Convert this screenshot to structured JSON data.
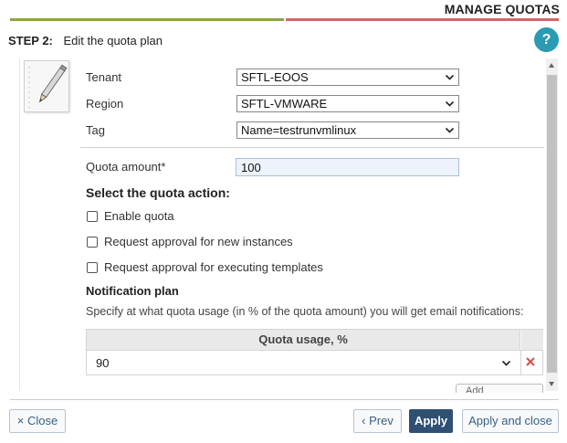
{
  "window": {
    "title": "MANAGE QUOTAS"
  },
  "step": {
    "number": "STEP 2:",
    "title": "Edit the quota plan"
  },
  "help": {
    "label": "?"
  },
  "fields": {
    "tenant": {
      "label": "Tenant",
      "value": "SFTL-EOOS"
    },
    "region": {
      "label": "Region",
      "value": "SFTL-VMWARE"
    },
    "tag": {
      "label": "Tag",
      "value": "Name=testrunvmlinux"
    },
    "quota_amount": {
      "label": "Quota amount*",
      "value": "100"
    }
  },
  "action_section": {
    "title": "Select the quota action:",
    "options": [
      {
        "label": "Enable quota",
        "checked": false
      },
      {
        "label": "Request approval for new instances",
        "checked": false
      },
      {
        "label": "Request approval for executing templates",
        "checked": false
      }
    ]
  },
  "notification": {
    "title": "Notification plan",
    "hint": "Specify at what quota usage (in % of the quota amount) you will get email notifications:",
    "table": {
      "header": "Quota usage, %",
      "rows": [
        {
          "value": "90"
        }
      ]
    },
    "add_label": "Add"
  },
  "footer": {
    "close_label": "Close",
    "prev_label": "Prev",
    "apply_label": "Apply",
    "apply_close_label": "Apply and close"
  },
  "colors": {
    "progress_done": "#8fa34a",
    "progress_todo": "#c56b6b",
    "help": "#2b9ab3",
    "primary": "#2f4f73",
    "delete": "#d9534f"
  },
  "icons": {
    "close": "close-icon",
    "prev": "chevron-left-icon",
    "dropdown": "chevron-down-icon",
    "delete": "delete-x-icon",
    "step_image": "pencil-icon"
  }
}
